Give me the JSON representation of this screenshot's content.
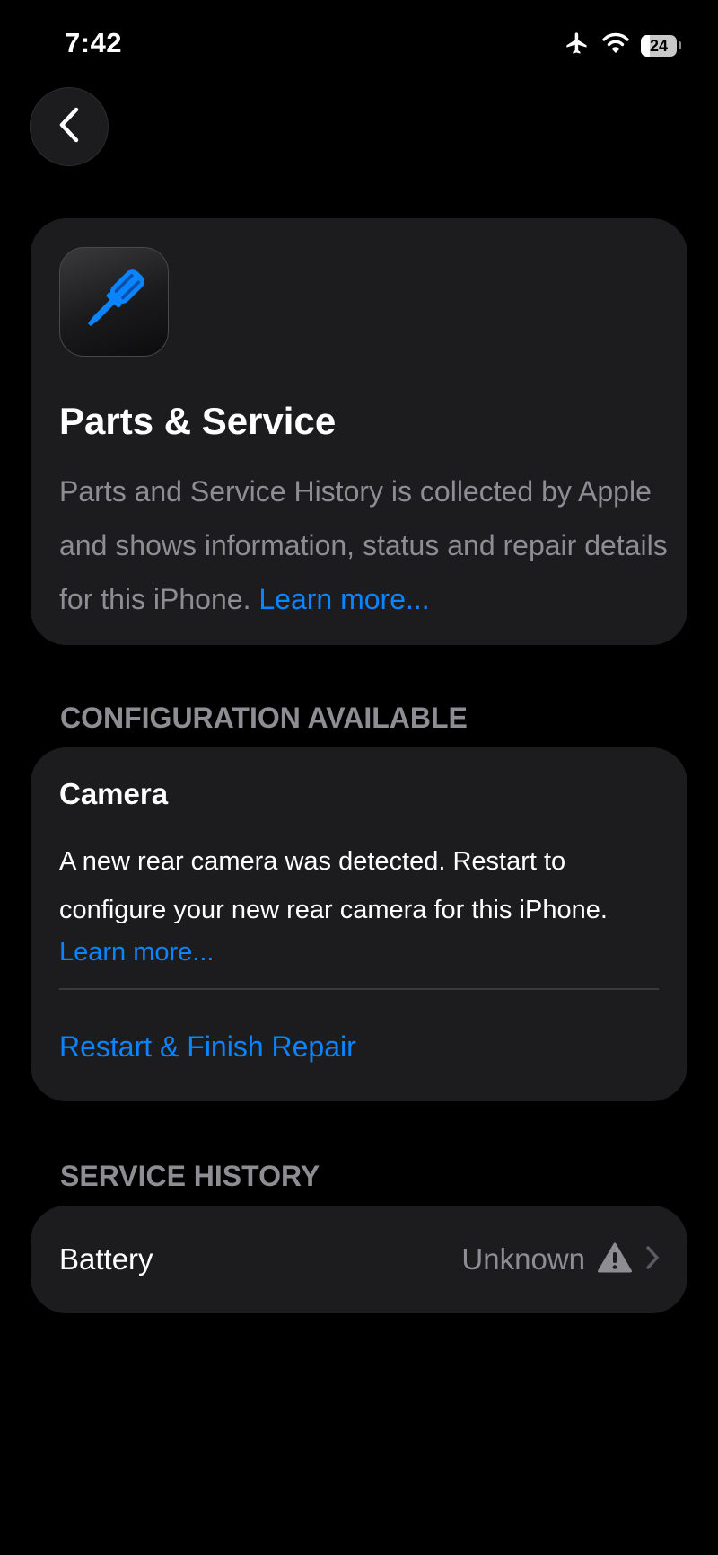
{
  "status_bar": {
    "time": "7:42",
    "battery_percent": "24",
    "battery_level": 0.24,
    "icons": [
      "airplane-icon",
      "wifi-icon",
      "battery-icon"
    ]
  },
  "nav": {
    "back_icon": "chevron-left-icon"
  },
  "hero": {
    "icon": "screwdriver-icon",
    "title": "Parts & Service",
    "description": "Parts and Service History is collected by Apple and shows information, status and repair details for this iPhone.",
    "learn_more": "Learn more..."
  },
  "configuration": {
    "header": "CONFIGURATION AVAILABLE",
    "item_title": "Camera",
    "item_description": "A new rear camera was detected. Restart to configure your new rear camera for this iPhone.",
    "learn_more": "Learn more...",
    "action_label": "Restart & Finish Repair"
  },
  "service_history": {
    "header": "SERVICE HISTORY",
    "items": [
      {
        "label": "Battery",
        "status": "Unknown",
        "status_icon": "warning-icon",
        "chevron_icon": "chevron-right-icon"
      }
    ]
  },
  "colors": {
    "background": "#000000",
    "card": "#1c1c1e",
    "accent": "#0a84ff",
    "secondary_text": "#8d8d93",
    "divider": "#3a3a3c"
  }
}
